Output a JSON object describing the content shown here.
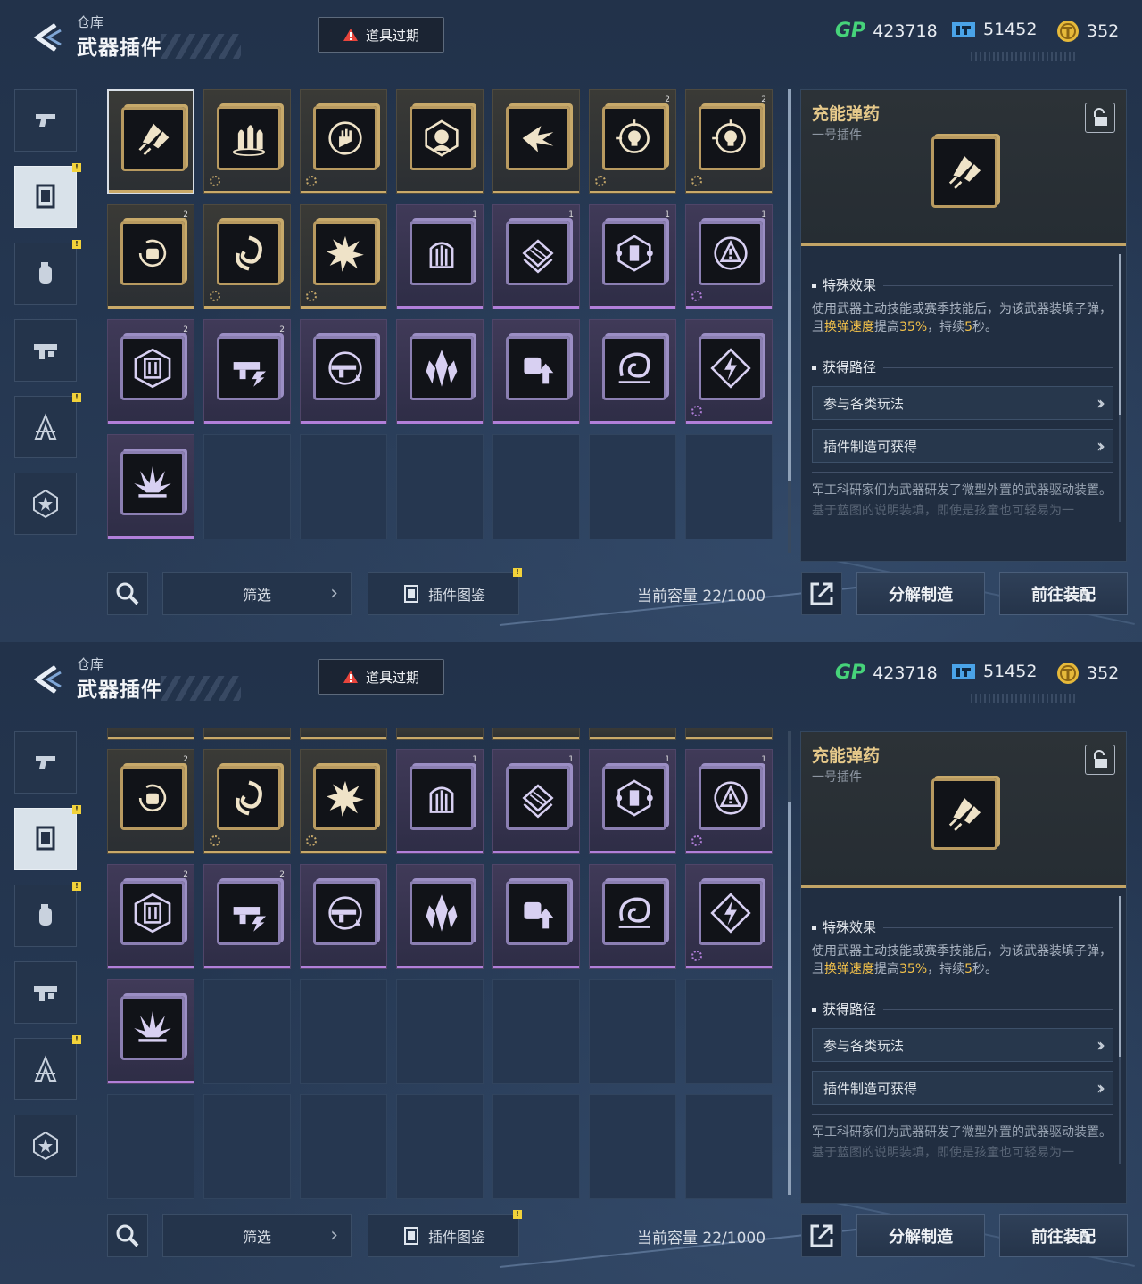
{
  "header": {
    "breadcrumb": "仓库",
    "title": "武器插件",
    "expire_button": "道具过期"
  },
  "currencies": [
    {
      "icon": "gp-logo",
      "label": "GP",
      "value": "423718"
    },
    {
      "icon": "ticket-icon",
      "value": "51452"
    },
    {
      "icon": "gold-coin-icon",
      "value": "352"
    }
  ],
  "categories": [
    {
      "name": "weapon-tab",
      "icon": "pistol-icon",
      "active": false,
      "alert": false
    },
    {
      "name": "plugin-tab",
      "icon": "plugin-chip-icon",
      "active": true,
      "alert": true
    },
    {
      "name": "grenade-tab",
      "icon": "grenade-icon",
      "active": false,
      "alert": true
    },
    {
      "name": "gun-parts-tab",
      "icon": "gun-parts-icon",
      "active": false,
      "alert": false
    },
    {
      "name": "blueprint-tab",
      "icon": "compass-icon",
      "active": false,
      "alert": true
    },
    {
      "name": "badge-tab",
      "icon": "star-badge-icon",
      "active": false,
      "alert": false
    }
  ],
  "plugins": [
    {
      "rarity": "gold",
      "icon": "rocket-ammo-icon",
      "level": "",
      "gear": false,
      "selected": true
    },
    {
      "rarity": "gold",
      "icon": "bullets-icon",
      "level": "",
      "gear": true
    },
    {
      "rarity": "gold",
      "icon": "hand-reload-icon",
      "level": "",
      "gear": true
    },
    {
      "rarity": "gold",
      "icon": "soldier-icon",
      "level": "",
      "gear": false
    },
    {
      "rarity": "gold",
      "icon": "arrow-burst-icon",
      "level": "",
      "gear": false
    },
    {
      "rarity": "gold",
      "icon": "skull-target-icon",
      "level": "2",
      "gear": true
    },
    {
      "rarity": "gold",
      "icon": "skull-target-icon",
      "level": "2",
      "gear": true
    },
    {
      "rarity": "gold",
      "icon": "fist-cycle-icon",
      "level": "2",
      "gear": false
    },
    {
      "rarity": "gold",
      "icon": "swirl-icon",
      "level": "",
      "gear": true
    },
    {
      "rarity": "gold",
      "icon": "explosion-icon",
      "level": "",
      "gear": true
    },
    {
      "rarity": "purple",
      "icon": "pillar-icon",
      "level": "1",
      "gear": false
    },
    {
      "rarity": "purple",
      "icon": "stack-icon",
      "level": "1",
      "gear": false
    },
    {
      "rarity": "purple",
      "icon": "hex-node-icon",
      "level": "1",
      "gear": false
    },
    {
      "rarity": "purple",
      "icon": "warning-cycle-icon",
      "level": "1",
      "gear": true
    },
    {
      "rarity": "purple",
      "icon": "shield-hex-icon",
      "level": "2",
      "gear": false
    },
    {
      "rarity": "purple",
      "icon": "gun-bolt-icon",
      "level": "2",
      "gear": false
    },
    {
      "rarity": "purple",
      "icon": "rifle-cycle-icon",
      "level": "",
      "gear": false
    },
    {
      "rarity": "purple",
      "icon": "crystal-icon",
      "level": "",
      "gear": false
    },
    {
      "rarity": "purple",
      "icon": "fist-up-icon",
      "level": "",
      "gear": false
    },
    {
      "rarity": "purple",
      "icon": "vortex-icon",
      "level": "",
      "gear": false
    },
    {
      "rarity": "purple",
      "icon": "lightning-diamond-icon",
      "level": "",
      "gear": true
    },
    {
      "rarity": "purple",
      "icon": "spike-burst-icon",
      "level": "",
      "gear": false
    }
  ],
  "toolbar": {
    "filter_label": "筛选",
    "codex_label": "插件图鉴",
    "capacity": "当前容量 22/1000",
    "decompose_label": "分解制造",
    "equip_label": "前往装配"
  },
  "detail": {
    "name": "充能弹药",
    "slot": "一号插件",
    "effect_title": "特殊效果",
    "effect_parts": [
      "使用武器主动技能或赛季技能后，为该武器装填子弹，且",
      "换弹速度",
      "提高",
      "35%",
      "，持续",
      "5",
      "秒。"
    ],
    "source_title": "获得路径",
    "sources": [
      "参与各类玩法",
      "插件制造可获得"
    ],
    "lore_1": "军工科研家们为武器研发了微型外置的武器驱动装置。",
    "lore_2": "基于蓝图的说明装填，即使是孩童也可轻易为一"
  },
  "colors": {
    "gold": "#c9a968",
    "purple": "#b17fd9",
    "highlight": "#f2c14a",
    "gp_green": "#46d37a"
  }
}
